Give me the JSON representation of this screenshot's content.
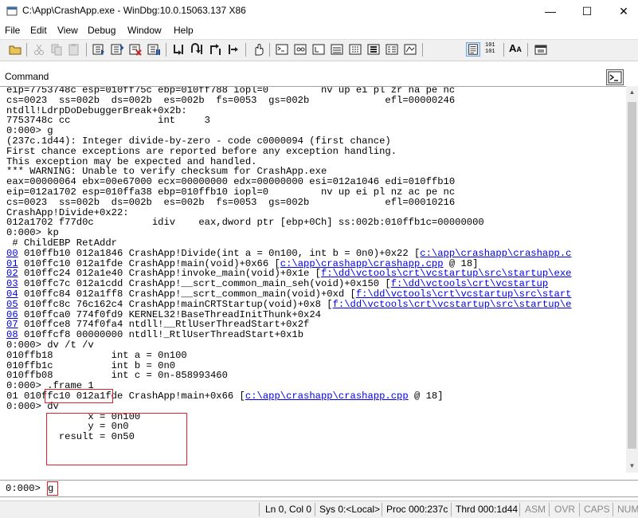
{
  "window": {
    "title": "C:\\App\\CrashApp.exe - WinDbg:10.0.15063.137 X86",
    "minimize_glyph": "—",
    "maximize_glyph": "☐",
    "close_glyph": "✕"
  },
  "menu": [
    "File",
    "Edit",
    "View",
    "Debug",
    "Window",
    "Help"
  ],
  "toolbar_icons": [
    "open-icon",
    "cut-icon",
    "copy-icon",
    "paste-icon",
    "go-icon",
    "restart-icon",
    "stop-debugging-icon",
    "break-icon",
    "step-into-icon",
    "step-over-icon",
    "step-out-icon",
    "run-to-cursor-icon",
    "breakpoint-icon",
    "command-window-icon",
    "watch-icon",
    "locals-icon",
    "registers-icon",
    "memory-icon",
    "call-stack-icon",
    "disassembly-icon",
    "scratch-pad-icon",
    "source-mode-icon",
    "font-icon",
    "options-icon"
  ],
  "command_window": {
    "title": "Command",
    "output_lines": [
      [
        "eip=7753748c esp=010ff75c ebp=010ff788 iopl=0         nv up ei pl zr na pe nc"
      ],
      [
        "cs=0023  ss=002b  ds=002b  es=002b  fs=0053  gs=002b             efl=00000246"
      ],
      [
        "ntdll!LdrpDoDebuggerBreak+0x2b:"
      ],
      [
        "7753748c cc               int     3"
      ],
      [
        "0:000> g"
      ],
      [
        "(237c.1d44): Integer divide-by-zero - code c0000094 (first chance)"
      ],
      [
        "First chance exceptions are reported before any exception handling."
      ],
      [
        "This exception may be expected and handled."
      ],
      [
        "*** WARNING: Unable to verify checksum for CrashApp.exe"
      ],
      [
        "eax=00000064 ebx=00e67000 ecx=00000000 edx=00000000 esi=012a1046 edi=010ffb10"
      ],
      [
        "eip=012a1702 esp=010ffa38 ebp=010ffb10 iopl=0         nv up ei pl nz ac pe nc"
      ],
      [
        "cs=0023  ss=002b  ds=002b  es=002b  fs=0053  gs=002b             efl=00010216"
      ],
      [
        "CrashApp!Divide+0x22:"
      ],
      [
        "012a1702 f77d0c          idiv    eax,dword ptr [ebp+0Ch] ss:002b:010ffb1c=00000000"
      ],
      [
        "0:000> kp"
      ],
      [
        " # ChildEBP RetAddr"
      ],
      [
        "",
        "00",
        " 010ffb10 012a1846 CrashApp!Divide(int a = 0n100, int b = 0n0)+0x22 [",
        "c:\\app\\crashapp\\crashapp.c"
      ],
      [
        "",
        "01",
        " 010ffc10 012a1fde CrashApp!main(void)+0x66 [",
        "c:\\app\\crashapp\\crashapp.cpp",
        " @ 18]"
      ],
      [
        "",
        "02",
        " 010ffc24 012a1e40 CrashApp!invoke_main(void)+0x1e [",
        "f:\\dd\\vctools\\crt\\vcstartup\\src\\startup\\exe"
      ],
      [
        "",
        "03",
        " 010ffc7c 012a1cdd CrashApp!__scrt_common_main_seh(void)+0x150 [",
        "f:\\dd\\vctools\\crt\\vcstartup"
      ],
      [
        "",
        "04",
        " 010ffc84 012a1ff8 CrashApp!__scrt_common_main(void)+0xd [",
        "f:\\dd\\vctools\\crt\\vcstartup\\src\\start"
      ],
      [
        "",
        "05",
        " 010ffc8c 76c162c4 CrashApp!mainCRTStartup(void)+0x8 [",
        "f:\\dd\\vctools\\crt\\vcstartup\\src\\startup\\e"
      ],
      [
        "",
        "06",
        " 010ffca0 774f0fd9 KERNEL32!BaseThreadInitThunk+0x24"
      ],
      [
        "",
        "07",
        " 010ffce8 774f0fa4 ntdll!__RtlUserThreadStart+0x2f"
      ],
      [
        "",
        "08",
        " 010ffcf8 00000000 ntdll!_RtlUserThreadStart+0x1b"
      ],
      [
        "0:000> dv /t /v"
      ],
      [
        "010ffb18          int a = 0n100"
      ],
      [
        "010ffb1c          int b = 0n0"
      ],
      [
        "010ffb08          int c = 0n-858993460"
      ],
      [
        "0:000> .frame 1"
      ],
      [
        "01 010ffc10 012a1fde CrashApp!main+0x66 [",
        "c:\\app\\crashapp\\crashapp.cpp",
        " @ 18]"
      ],
      [
        "0:000> dv"
      ],
      [
        "              x = 0n100"
      ],
      [
        "              y = 0n0"
      ],
      [
        "         result = 0n50"
      ]
    ]
  },
  "input": {
    "prompt": "0:000>",
    "value": "g"
  },
  "status_bar": {
    "ln_col": "Ln 0, Col 0",
    "sys": "Sys 0:<Local>",
    "proc": "Proc 000:237c",
    "thrd": "Thrd 000:1d44",
    "asm": "ASM",
    "ovr": "OVR",
    "caps": "CAPS",
    "num": "NUM"
  }
}
